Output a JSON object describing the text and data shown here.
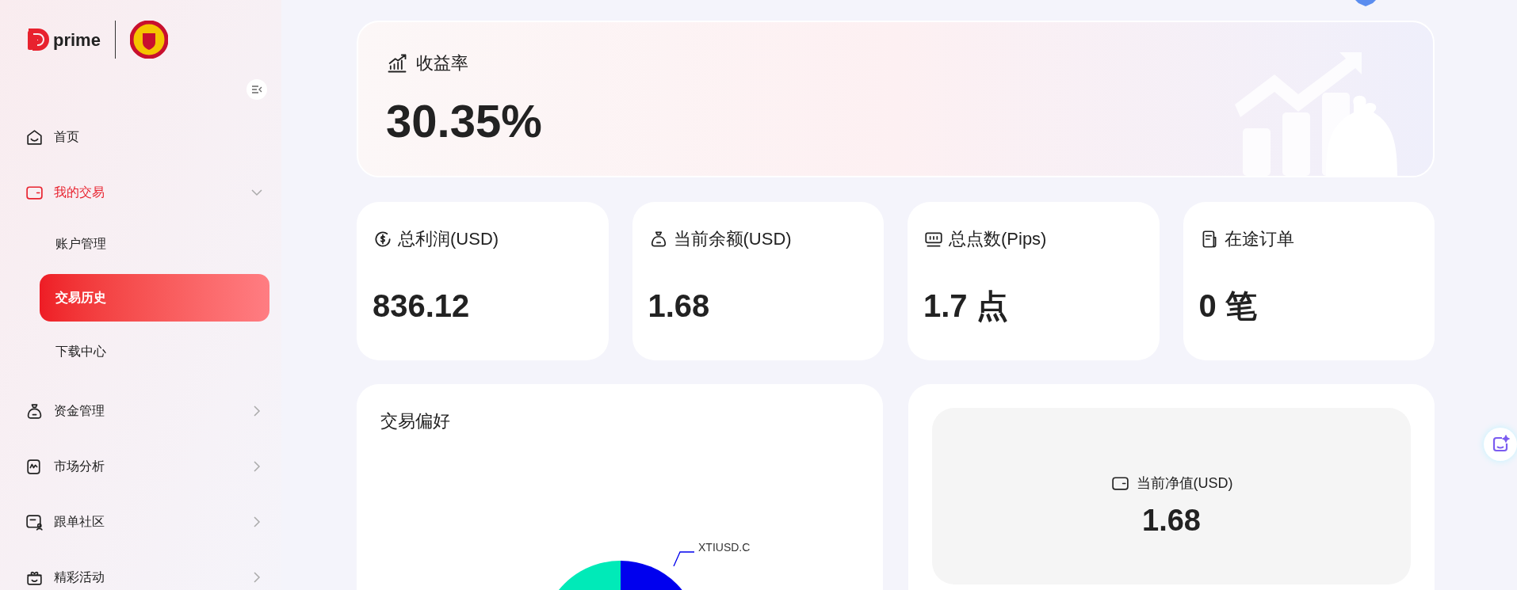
{
  "brand": {
    "name": "prime"
  },
  "sidebar": {
    "items": [
      {
        "label": "首页",
        "kind": "link",
        "active": false
      },
      {
        "label": "我的交易",
        "kind": "group",
        "active": true,
        "expanded": true,
        "children": [
          {
            "label": "账户管理",
            "selected": false
          },
          {
            "label": "交易历史",
            "selected": true
          },
          {
            "label": "下载中心",
            "selected": false
          }
        ]
      },
      {
        "label": "资金管理",
        "kind": "group",
        "active": false,
        "expanded": false
      },
      {
        "label": "市场分析",
        "kind": "group",
        "active": false,
        "expanded": false
      },
      {
        "label": "跟单社区",
        "kind": "group",
        "active": false,
        "expanded": false
      },
      {
        "label": "精彩活动",
        "kind": "group",
        "active": false,
        "expanded": false
      }
    ]
  },
  "return_card": {
    "title": "收益率",
    "value": "30.35%"
  },
  "stats": [
    {
      "title": "总利润(USD)",
      "value": "836.12"
    },
    {
      "title": "当前余额(USD)",
      "value": "1.68"
    },
    {
      "title": "总点数(Pips)",
      "value": "1.7 点"
    },
    {
      "title": "在途订单",
      "value": "0 笔"
    }
  ],
  "preference_card": {
    "title": "交易偏好",
    "pie_label": "XTIUSD.C"
  },
  "equity_card": {
    "title": "当前净值(USD)",
    "value": "1.68"
  }
}
